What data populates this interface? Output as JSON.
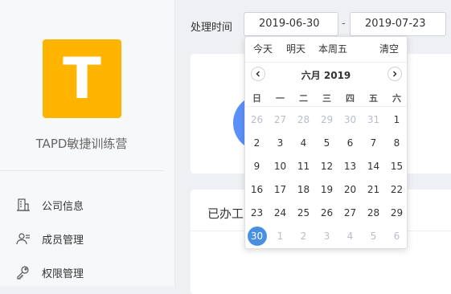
{
  "sidebar": {
    "logo_letter": "T",
    "company_name": "TAPD敏捷训练营",
    "items": [
      {
        "label": "公司信息",
        "icon": "building-icon"
      },
      {
        "label": "成员管理",
        "icon": "users-icon"
      },
      {
        "label": "权限管理",
        "icon": "key-icon"
      }
    ]
  },
  "filter": {
    "label": "处理时间",
    "start_date": "2019-06-30",
    "separator": "-",
    "end_date": "2019-07-23"
  },
  "card2": {
    "title": "已办工"
  },
  "datepicker": {
    "quick": [
      "今天",
      "明天",
      "本周五",
      "清空"
    ],
    "month_title": "六月 2019",
    "weekdays": [
      "日",
      "一",
      "二",
      "三",
      "四",
      "五",
      "六"
    ],
    "prev_icon": "chevron-left-icon",
    "next_icon": "chevron-right-icon",
    "weeks": [
      [
        "26",
        "27",
        "28",
        "29",
        "30",
        "31",
        "1"
      ],
      [
        "2",
        "3",
        "4",
        "5",
        "6",
        "7",
        "8"
      ],
      [
        "9",
        "10",
        "11",
        "12",
        "13",
        "14",
        "15"
      ],
      [
        "16",
        "17",
        "18",
        "19",
        "20",
        "21",
        "22"
      ],
      [
        "23",
        "24",
        "25",
        "26",
        "27",
        "28",
        "29"
      ],
      [
        "30",
        "1",
        "2",
        "3",
        "4",
        "5",
        "6"
      ]
    ],
    "selected_day": "30",
    "accent_color": "#4a90e2"
  }
}
